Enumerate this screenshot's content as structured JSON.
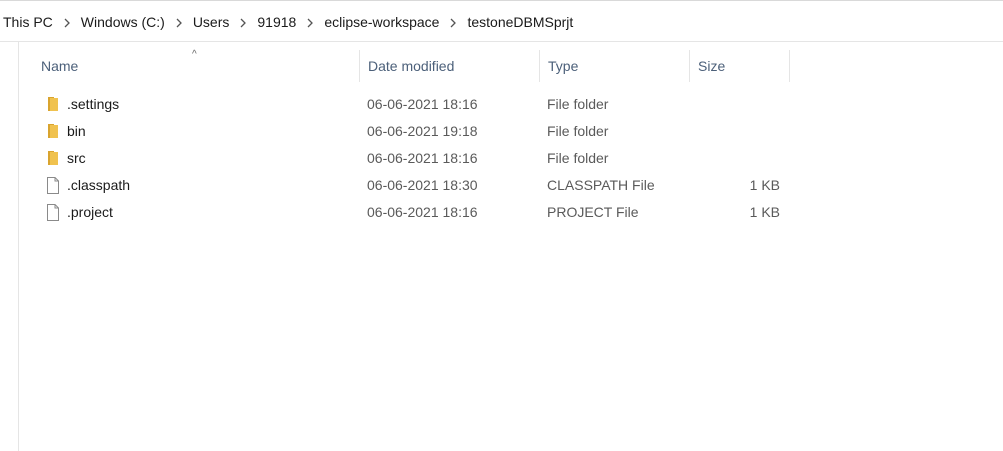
{
  "breadcrumb": [
    "This PC",
    "Windows (C:)",
    "Users",
    "91918",
    "eclipse-workspace",
    "testoneDBMSprjt"
  ],
  "columns": {
    "name": "Name",
    "date": "Date modified",
    "type": "Type",
    "size": "Size"
  },
  "sort_indicator": "^",
  "files": [
    {
      "name": ".settings",
      "date": "06-06-2021 18:16",
      "type": "File folder",
      "size": "",
      "icon": "folder-icon"
    },
    {
      "name": "bin",
      "date": "06-06-2021 19:18",
      "type": "File folder",
      "size": "",
      "icon": "folder-icon"
    },
    {
      "name": "src",
      "date": "06-06-2021 18:16",
      "type": "File folder",
      "size": "",
      "icon": "folder-icon"
    },
    {
      "name": ".classpath",
      "date": "06-06-2021 18:30",
      "type": "CLASSPATH File",
      "size": "1 KB",
      "icon": "file-icon"
    },
    {
      "name": ".project",
      "date": "06-06-2021 18:16",
      "type": "PROJECT File",
      "size": "1 KB",
      "icon": "file-icon"
    }
  ],
  "colors": {
    "folder": "#e8b84a",
    "folder_dark": "#d9a42f",
    "header_text": "#4c607a"
  }
}
